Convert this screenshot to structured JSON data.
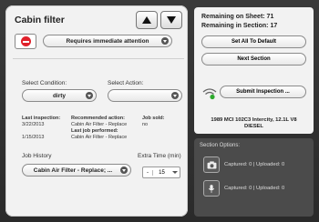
{
  "left": {
    "title": "Cabin filter",
    "severity": "Requires immediate attention",
    "condition_label": "Select Condition:",
    "condition_value": "dirty",
    "action_label": "Select Action:",
    "action_value": "",
    "last_inspection_label": "Last inspection:",
    "last_inspection_dates": [
      "3/22/2013",
      "1/15/2013"
    ],
    "recommended_action_label": "Recommended action:",
    "recommended_action_value": "Cabin Air Filter - Replace",
    "last_job_label": "Last job performed:",
    "last_job_value": "Cabin Air Filter - Replace",
    "job_sold_label": "Job sold:",
    "job_sold_value": "no",
    "job_history_label": "Job History",
    "job_history_value": "Cabin Air Filter - Replace; ...",
    "extra_time_label": "Extra Time (min)",
    "extra_time_minus": "-",
    "extra_time_value": "15"
  },
  "right": {
    "remaining_sheet": "Remaining on Sheet: 71",
    "remaining_section": "Remaining in Section: 17",
    "set_default_label": "Set All To Default",
    "next_section_label": "Next Section",
    "submit_label": "Submit Inspection ...",
    "vehicle_line1": "1989 MCI 102C3 Intercity, 12.1L V8",
    "vehicle_line2": "DIESEL",
    "section_options_label": "Section Options:",
    "photo_status": "Captured: 0 | Uploaded: 0",
    "audio_status": "Captured: 0 | Uploaded: 0"
  }
}
